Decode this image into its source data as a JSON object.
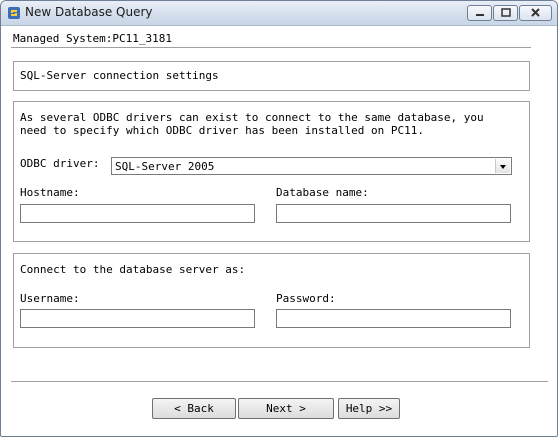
{
  "window": {
    "title": "New Database Query"
  },
  "header": {
    "managed_system": "Managed System:PC11_3181"
  },
  "section1": {
    "title": "SQL-Server connection settings"
  },
  "section2": {
    "description_line1": "As several ODBC drivers can exist to connect to the same database, you",
    "description_line2": "need to specify which ODBC driver has been installed on PC11.",
    "odbc_label": "ODBC driver:",
    "odbc_value": "SQL-Server 2005",
    "hostname_label": "Hostname:",
    "hostname_value": "",
    "database_label": "Database name:",
    "database_value": ""
  },
  "section3": {
    "title": "Connect to the database server as:",
    "username_label": "Username:",
    "username_value": "",
    "password_label": "Password:",
    "password_value": ""
  },
  "buttons": {
    "back": "< Back",
    "next": "Next >",
    "help": "Help >>"
  }
}
